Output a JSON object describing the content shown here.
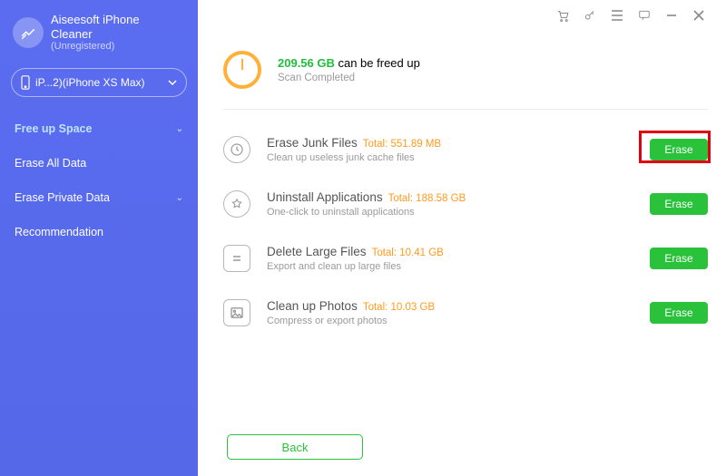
{
  "app": {
    "name": "Aiseesoft iPhone",
    "line2": "Cleaner",
    "status": "(Unregistered)"
  },
  "device": {
    "label": "iP...2)(iPhone XS Max)"
  },
  "nav": {
    "free_space": "Free up Space",
    "erase_all": "Erase All Data",
    "erase_private": "Erase Private Data",
    "recommend": "Recommendation"
  },
  "summary": {
    "amount": "209.56 GB",
    "tail": " can be freed up",
    "status": "Scan Completed"
  },
  "items": [
    {
      "title": "Erase Junk Files",
      "total_label": "Total: 551.89 MB",
      "desc": "Clean up useless junk cache files",
      "btn": "Erase"
    },
    {
      "title": "Uninstall Applications",
      "total_label": "Total: 188.58 GB",
      "desc": "One-click to uninstall applications",
      "btn": "Erase"
    },
    {
      "title": "Delete Large Files",
      "total_label": "Total: 10.41 GB",
      "desc": "Export and clean up large files",
      "btn": "Erase"
    },
    {
      "title": "Clean up Photos",
      "total_label": "Total: 10.03 GB",
      "desc": "Compress or export photos",
      "btn": "Erase"
    }
  ],
  "buttons": {
    "back": "Back"
  }
}
